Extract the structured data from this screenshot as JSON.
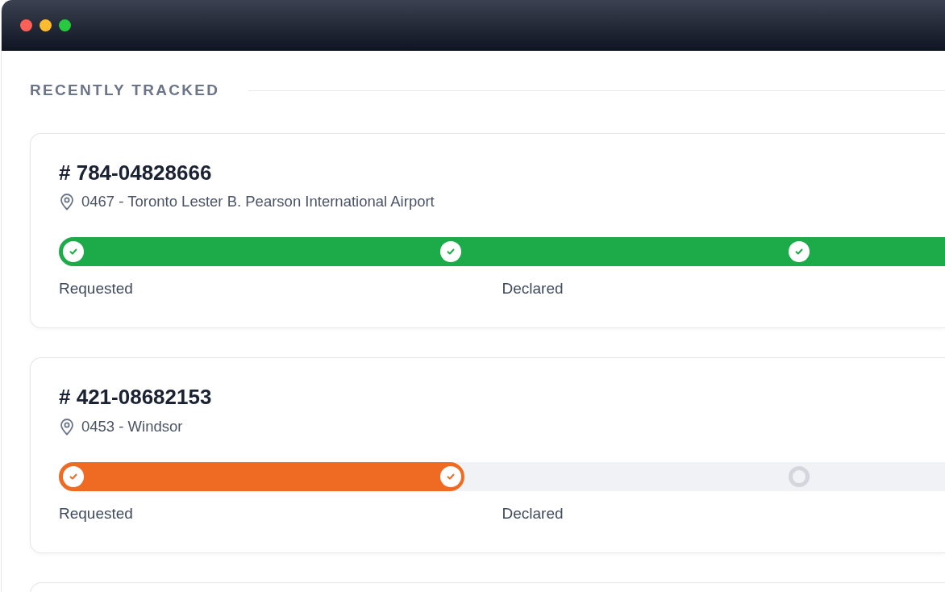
{
  "section": {
    "title": "RECENTLY TRACKED"
  },
  "shipments": [
    {
      "number": "# 784-04828666",
      "location": "0467 - Toronto Lester B. Pearson International Airport",
      "color": "#1cab48",
      "level": 1,
      "steps": [
        {
          "done": true
        },
        {
          "done": true
        },
        {
          "done": true
        }
      ],
      "labels": [
        "Requested",
        "Declared"
      ]
    },
    {
      "number": "# 421-08682153",
      "location": "0453 - Windsor",
      "color": "#ef6a22",
      "level": 0.458,
      "steps": [
        {
          "done": true
        },
        {
          "done": true
        },
        {
          "done": false
        }
      ],
      "labels": [
        "Requested",
        "Declared"
      ]
    }
  ]
}
